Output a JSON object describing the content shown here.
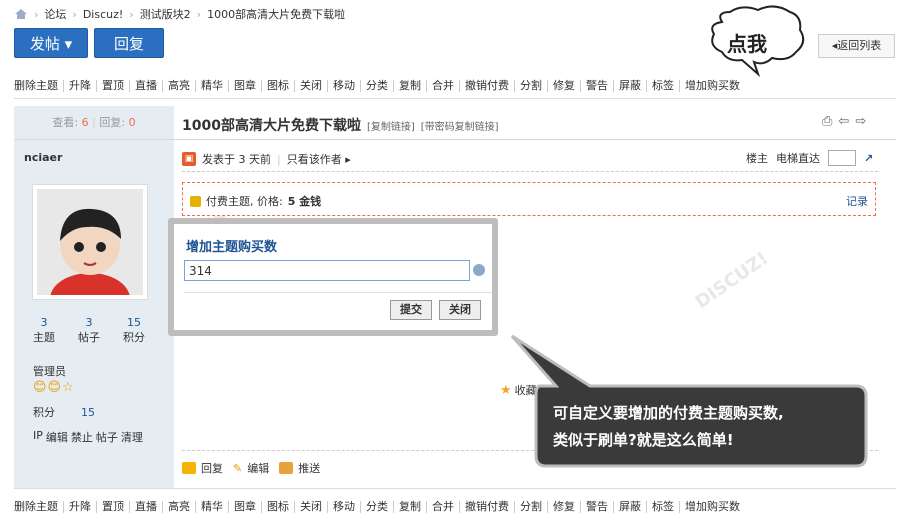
{
  "breadcrumb": {
    "items": [
      "论坛",
      "Discuz!",
      "测试版块2",
      "1000部高清大片免费下载啦"
    ]
  },
  "buttons": {
    "post": "发帖 ▾",
    "reply": "回复",
    "back": "◂返回列表"
  },
  "toolbar": {
    "items": [
      "删除主题",
      "升降",
      "置顶",
      "直播",
      "高亮",
      "精华",
      "图章",
      "图标",
      "关闭",
      "移动",
      "分类",
      "复制",
      "合并",
      "撤销付费",
      "分割",
      "修复",
      "警告",
      "屏蔽",
      "标签",
      "增加购买数"
    ]
  },
  "thread": {
    "views_label": "查看:",
    "views": "6",
    "replies_label": "回复:",
    "replies": "0",
    "title": "1000部高清大片免费下载啦",
    "copy_link": "[复制链接]",
    "copy_pwd_link": "[带密码复制链接]"
  },
  "author": {
    "name": "nciaer",
    "stats": [
      {
        "value": "3",
        "label": "主题"
      },
      {
        "value": "3",
        "label": "帖子"
      },
      {
        "value": "15",
        "label": "积分"
      }
    ],
    "role": "管理员",
    "medals": "😊😊☆",
    "points_label": "积分",
    "points": "15",
    "actions": [
      "IP",
      "编辑",
      "禁止",
      "帖子",
      "清理"
    ]
  },
  "post": {
    "meta": "发表于 3 天前",
    "only_author": "只看该作者 ▸",
    "op_label": "楼主",
    "jump_label": "电梯直达",
    "pay_text": "付费主题, 价格:",
    "pay_price": "5 金钱",
    "pay_log": "记录",
    "favorite": "收藏",
    "actions": [
      "回复",
      "编辑",
      "推送"
    ]
  },
  "dialog": {
    "title": "增加主题购买数",
    "value": "314",
    "submit": "提交",
    "close": "关闭"
  },
  "callouts": {
    "click": "点我",
    "line1": "可自定义要增加的付费主题购买数,",
    "line2": "类似于刷单?就是这么简单!"
  },
  "colors": {
    "primary": "#2b70c0",
    "link": "#1e5494",
    "accent": "#f26c4f",
    "sidebar": "#e5edf2"
  }
}
